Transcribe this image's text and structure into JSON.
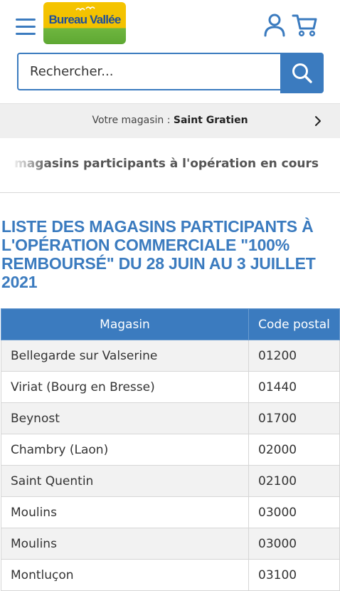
{
  "header": {
    "logo_text": "Bureau Vallée",
    "colors": {
      "accent": "#3b7bbf",
      "logo_yellow": "#f5c400",
      "logo_green": "#6fb63f"
    }
  },
  "search": {
    "placeholder": "Rechercher..."
  },
  "store_bar": {
    "label": "Votre magasin :",
    "store_name": "Saint Gratien"
  },
  "marquee": {
    "text": "es magasins participants à l'opération en cours"
  },
  "page_title": "LISTE DES MAGASINS PARTICIPANTS À L'OPÉRATION COMMERCIALE \"100% REMBOURSÉ\" DU 28 JUIN AU 3 JUILLET 2021",
  "table": {
    "headers": [
      "Magasin",
      "Code postal"
    ],
    "rows": [
      [
        "Bellegarde sur Valserine",
        "01200"
      ],
      [
        "Viriat (Bourg en Bresse)",
        "01440"
      ],
      [
        "Beynost",
        "01700"
      ],
      [
        "Chambry (Laon)",
        "02000"
      ],
      [
        "Saint Quentin",
        "02100"
      ],
      [
        "Moulins",
        "03000"
      ],
      [
        "Moulins",
        "03000"
      ],
      [
        "Montluçon",
        "03100"
      ]
    ]
  }
}
